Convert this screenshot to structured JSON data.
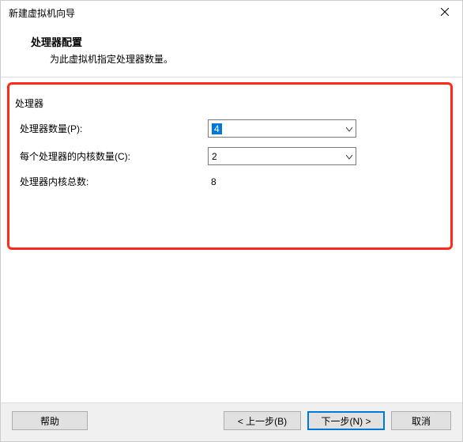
{
  "window": {
    "title": "新建虚拟机向导"
  },
  "header": {
    "title": "处理器配置",
    "subtitle": "为此虚拟机指定处理器数量。"
  },
  "form": {
    "group_label": "处理器",
    "processors": {
      "label": "处理器数量(P):",
      "value": "4"
    },
    "cores": {
      "label": "每个处理器的内核数量(C):",
      "value": "2"
    },
    "total": {
      "label": "处理器内核总数:",
      "value": "8"
    }
  },
  "footer": {
    "help": "帮助",
    "back": "< 上一步(B)",
    "next": "下一步(N) >",
    "cancel": "取消"
  }
}
